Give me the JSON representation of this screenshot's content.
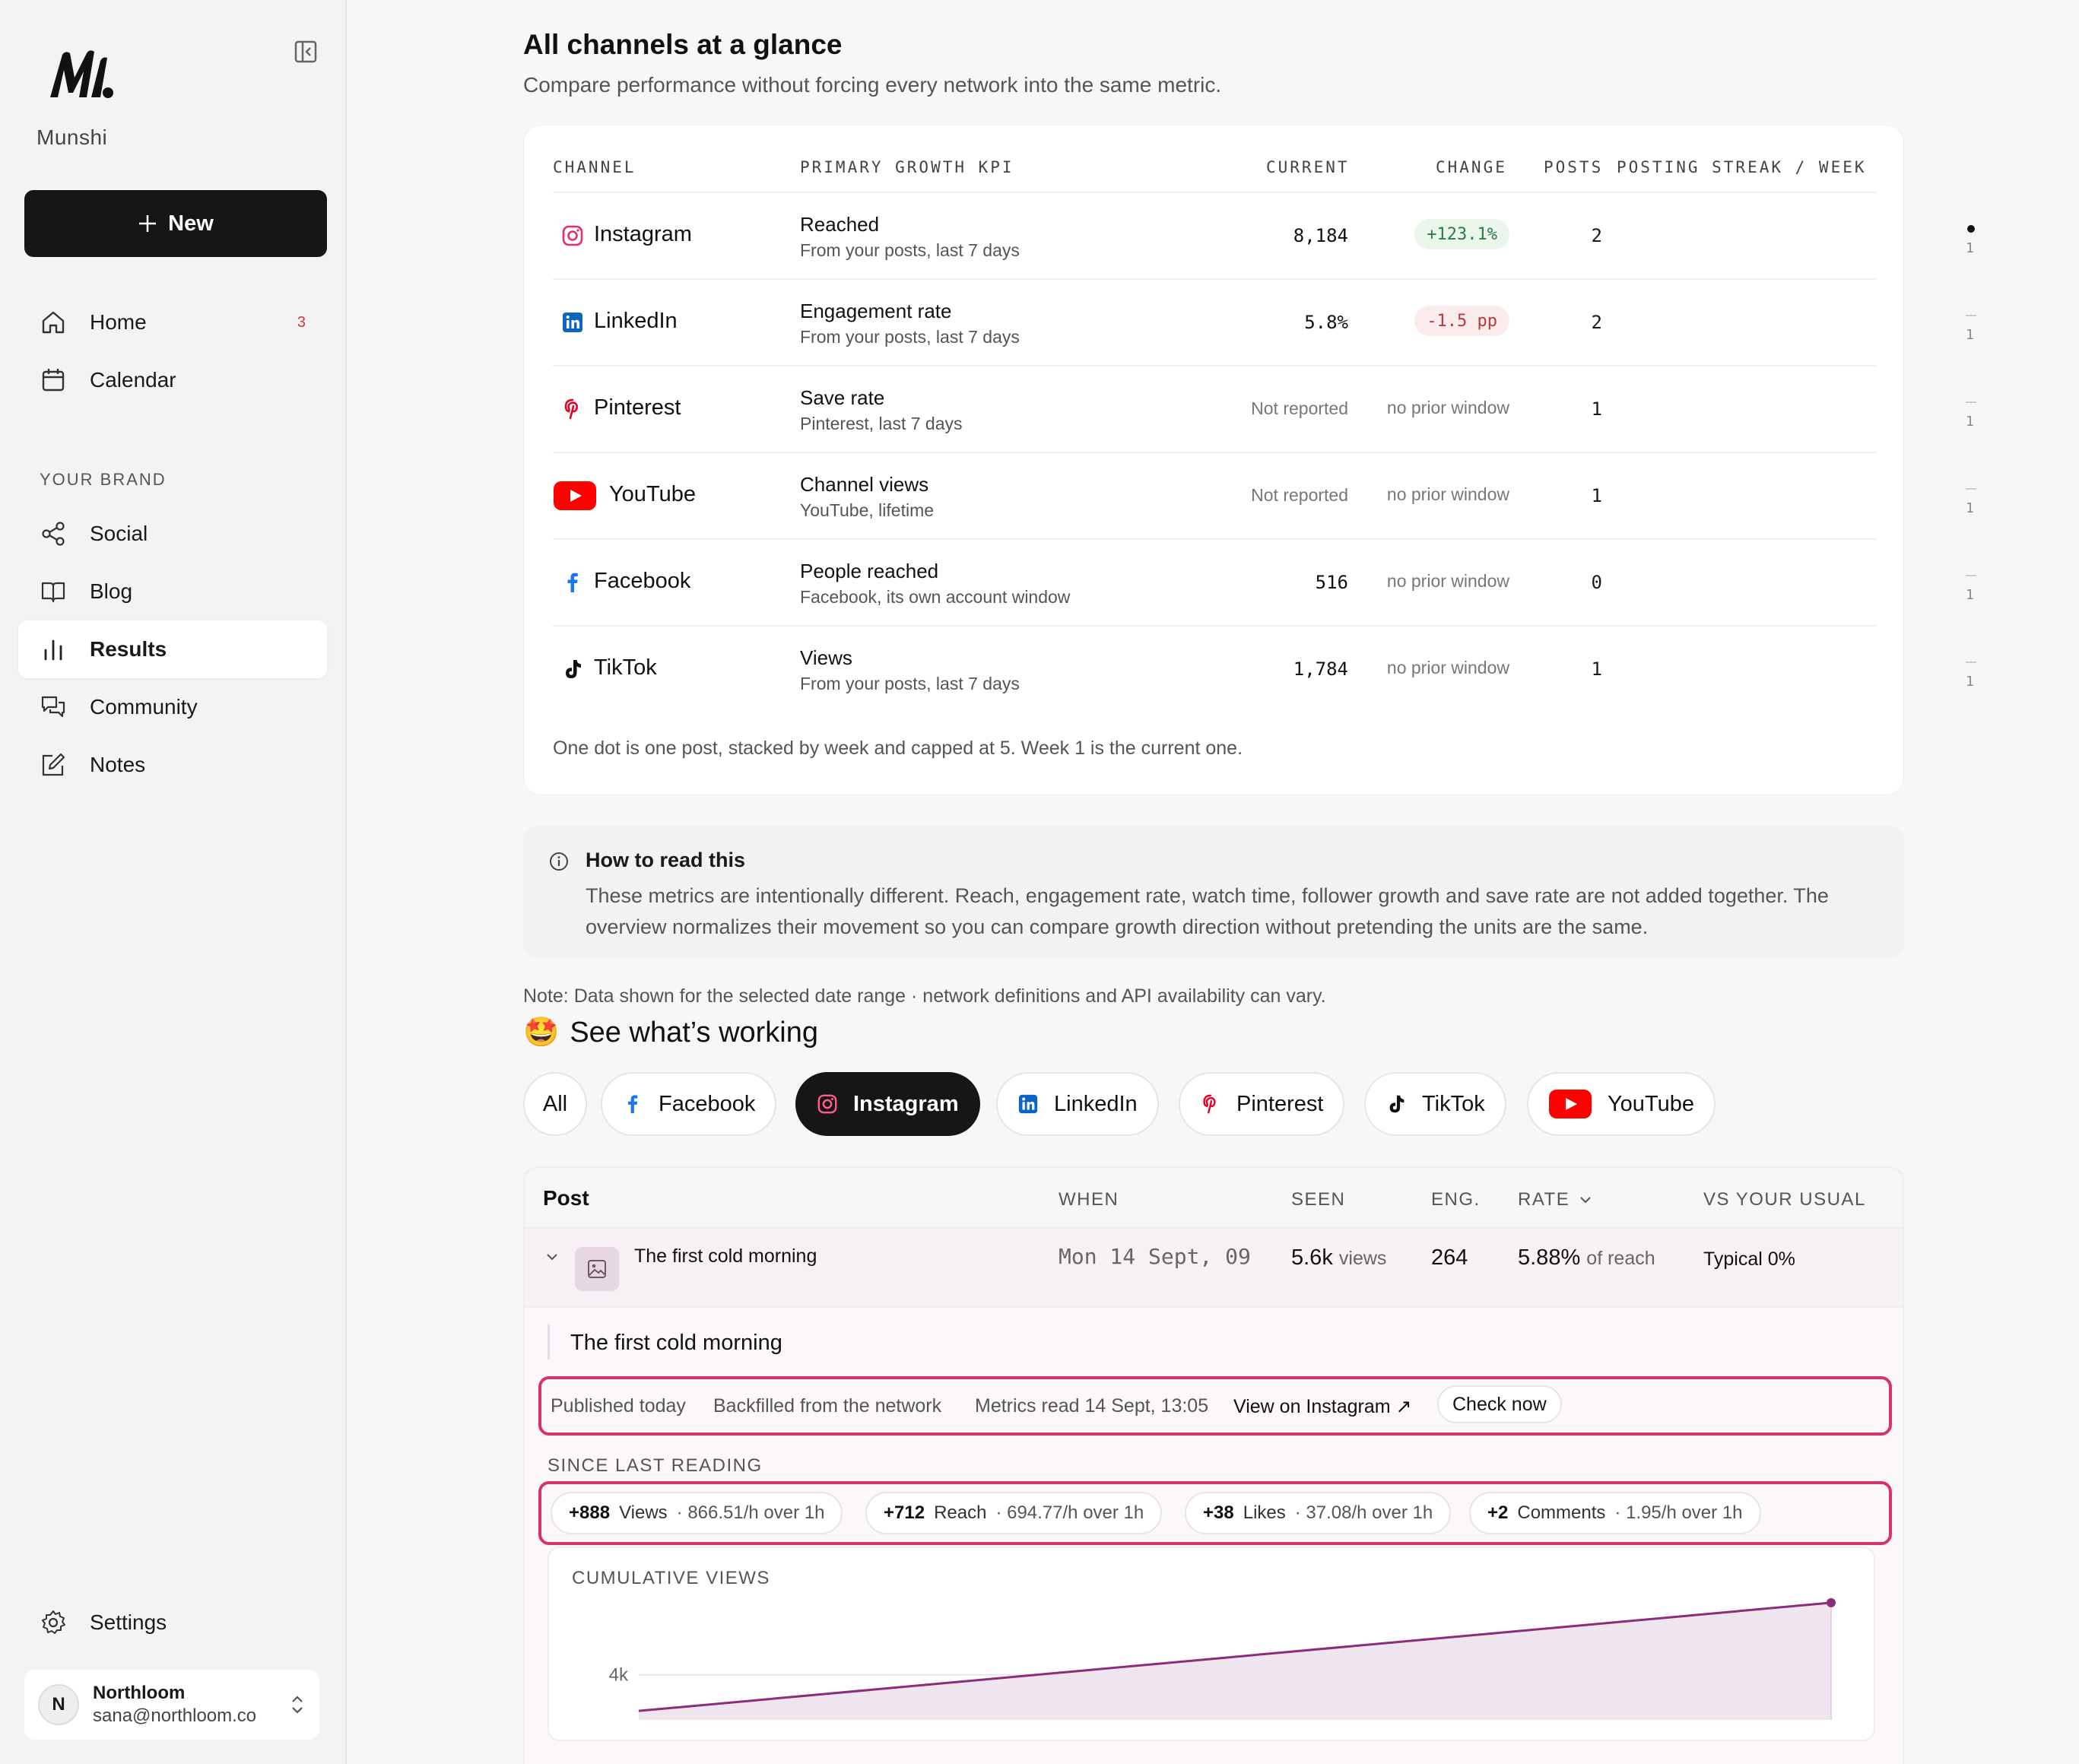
{
  "sidebar": {
    "brand": "Munshi",
    "new_label": "New",
    "nav": [
      {
        "label": "Home",
        "badge": "3"
      },
      {
        "label": "Calendar"
      }
    ],
    "section_label": "YOUR BRAND",
    "brand_nav": [
      {
        "label": "Social"
      },
      {
        "label": "Blog"
      },
      {
        "label": "Results"
      },
      {
        "label": "Community"
      },
      {
        "label": "Notes"
      }
    ],
    "settings_label": "Settings",
    "account": {
      "initial": "N",
      "name": "Northloom",
      "email": "sana@northloom.co"
    }
  },
  "overview": {
    "title": "All channels at a glance",
    "subtitle": "Compare performance without forcing every network into the same metric.",
    "columns": [
      "CHANNEL",
      "PRIMARY GROWTH KPI",
      "CURRENT",
      "CHANGE",
      "POSTS",
      "POSTING STREAK / WEEK"
    ],
    "rows": [
      {
        "channel": "Instagram",
        "icon": "instagram-icon",
        "kpi": "Reached",
        "kpi_sub": "From your posts, last 7 days",
        "current": "8,184",
        "change": "+123.1%",
        "change_type": "pos",
        "posts": "2",
        "streak_week": "1",
        "streak_dots": 1
      },
      {
        "channel": "LinkedIn",
        "icon": "linkedin-icon",
        "kpi": "Engagement rate",
        "kpi_sub": "From your posts, last 7 days",
        "current": "5.8%",
        "change": "-1.5 pp",
        "change_type": "neg",
        "posts": "2",
        "streak_week": "1",
        "streak_dots": 0
      },
      {
        "channel": "Pinterest",
        "icon": "pinterest-icon",
        "kpi": "Save rate",
        "kpi_sub": "Pinterest, last 7 days",
        "current": "Not reported",
        "change": "no prior window",
        "change_type": "none",
        "posts": "1",
        "streak_week": "1",
        "streak_dots": 0
      },
      {
        "channel": "YouTube",
        "icon": "youtube-icon",
        "kpi": "Channel views",
        "kpi_sub": "YouTube, lifetime",
        "current": "Not reported",
        "change": "no prior window",
        "change_type": "none",
        "posts": "1",
        "streak_week": "1",
        "streak_dots": 0
      },
      {
        "channel": "Facebook",
        "icon": "facebook-icon",
        "kpi": "People reached",
        "kpi_sub": "Facebook, its own account window",
        "current": "516",
        "change": "no prior window",
        "change_type": "none",
        "posts": "0",
        "streak_week": "1",
        "streak_dots": 0
      },
      {
        "channel": "TikTok",
        "icon": "tiktok-icon",
        "kpi": "Views",
        "kpi_sub": "From your posts, last 7 days",
        "current": "1,784",
        "change": "no prior window",
        "change_type": "none",
        "posts": "1",
        "streak_week": "1",
        "streak_dots": 0
      }
    ],
    "footnote": "One dot is one post, stacked by week and capped at 5. Week 1 is the current one."
  },
  "howto": {
    "title": "How to read this",
    "body": "These metrics are intentionally different. Reach, engagement rate, watch time, follower growth and save rate are not added together. The overview normalizes their movement so you can compare growth direction without pretending the units are the same."
  },
  "note": "Note: Data shown for the selected date range · network definitions and API availability can vary.",
  "working": {
    "emoji": "🤩",
    "title": "See what’s working",
    "filters": [
      "All",
      "Facebook",
      "Instagram",
      "LinkedIn",
      "Pinterest",
      "TikTok",
      "YouTube"
    ],
    "active_filter": "Instagram"
  },
  "posts_table": {
    "columns": [
      "Post",
      "WHEN",
      "SEEN",
      "ENG.",
      "RATE",
      "VS YOUR USUAL"
    ],
    "row": {
      "title": "The first cold morning",
      "when": "Mon 14 Sept, 09",
      "seen": "5.6k",
      "seen_unit": "views",
      "eng": "264",
      "rate": "5.88%",
      "rate_unit": "of reach",
      "vs_usual": "Typical 0%"
    },
    "detail": {
      "title": "The first cold morning",
      "meta": [
        "Published today",
        "Backfilled from the network",
        "Metrics read 14 Sept, 13:05"
      ],
      "view_link": "View on Instagram ↗",
      "check_now": "Check now",
      "since_label": "SINCE LAST READING",
      "stats": [
        {
          "delta": "+888",
          "label": "Views",
          "rate": "· 866.51/h over 1h"
        },
        {
          "delta": "+712",
          "label": "Reach",
          "rate": "· 694.77/h over 1h"
        },
        {
          "delta": "+38",
          "label": "Likes",
          "rate": "· 37.08/h over 1h"
        },
        {
          "delta": "+2",
          "label": "Comments",
          "rate": "· 1.95/h over 1h"
        }
      ]
    }
  },
  "chart_data": {
    "type": "area",
    "title": "CUMULATIVE VIEWS",
    "y_tick_labels": [
      "4k"
    ],
    "x": [
      0,
      1
    ],
    "values": [
      3200,
      5600
    ],
    "ylim": [
      3000,
      5800
    ],
    "grid": true,
    "color": "#8e2b7a"
  }
}
